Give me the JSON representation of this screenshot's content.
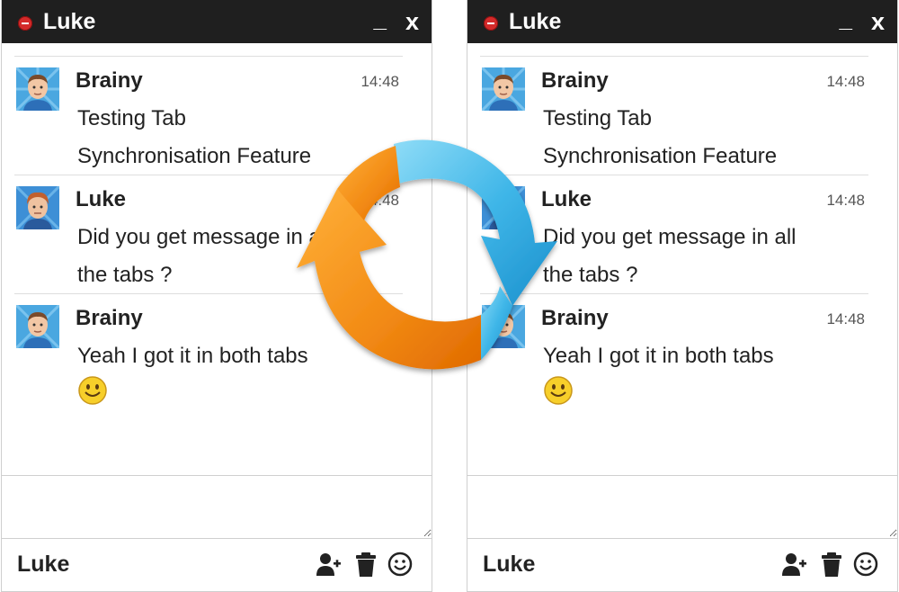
{
  "windows": [
    {
      "title": "Luke",
      "minimize_label": "_",
      "close_label": "x",
      "messages": [
        {
          "sender": "Brainy",
          "time": "14:48",
          "lines": [
            "Testing Tab",
            "Synchronisation Feature"
          ]
        },
        {
          "sender": "Luke",
          "time": "14:48",
          "lines": [
            "Did you get message in all",
            "the tabs ?"
          ]
        },
        {
          "sender": "Brainy",
          "time": "14:48",
          "lines": [
            "Yeah I got it in both tabs"
          ]
        }
      ],
      "footer_name": "Luke"
    },
    {
      "title": "Luke",
      "minimize_label": "_",
      "close_label": "x",
      "messages": [
        {
          "sender": "Brainy",
          "time": "14:48",
          "lines": [
            "Testing Tab",
            "Synchronisation Feature"
          ]
        },
        {
          "sender": "Luke",
          "time": "14:48",
          "lines": [
            "Did you get message in all",
            "the tabs ?"
          ]
        },
        {
          "sender": "Brainy",
          "time": "14:48",
          "lines": [
            "Yeah I got it in both tabs"
          ]
        }
      ],
      "footer_name": "Luke"
    }
  ],
  "icons": {
    "status": "status-busy-icon",
    "add_user": "add-user-icon",
    "trash": "trash-icon",
    "emoji": "emoji-icon",
    "smiley": "smiley-emoticon",
    "sync": "sync-arrows-icon"
  },
  "colors": {
    "titlebar": "#1f1f1f",
    "status_red": "#d42a2a",
    "sync_orange": "#f28a14",
    "sync_blue": "#3fb6e8"
  }
}
